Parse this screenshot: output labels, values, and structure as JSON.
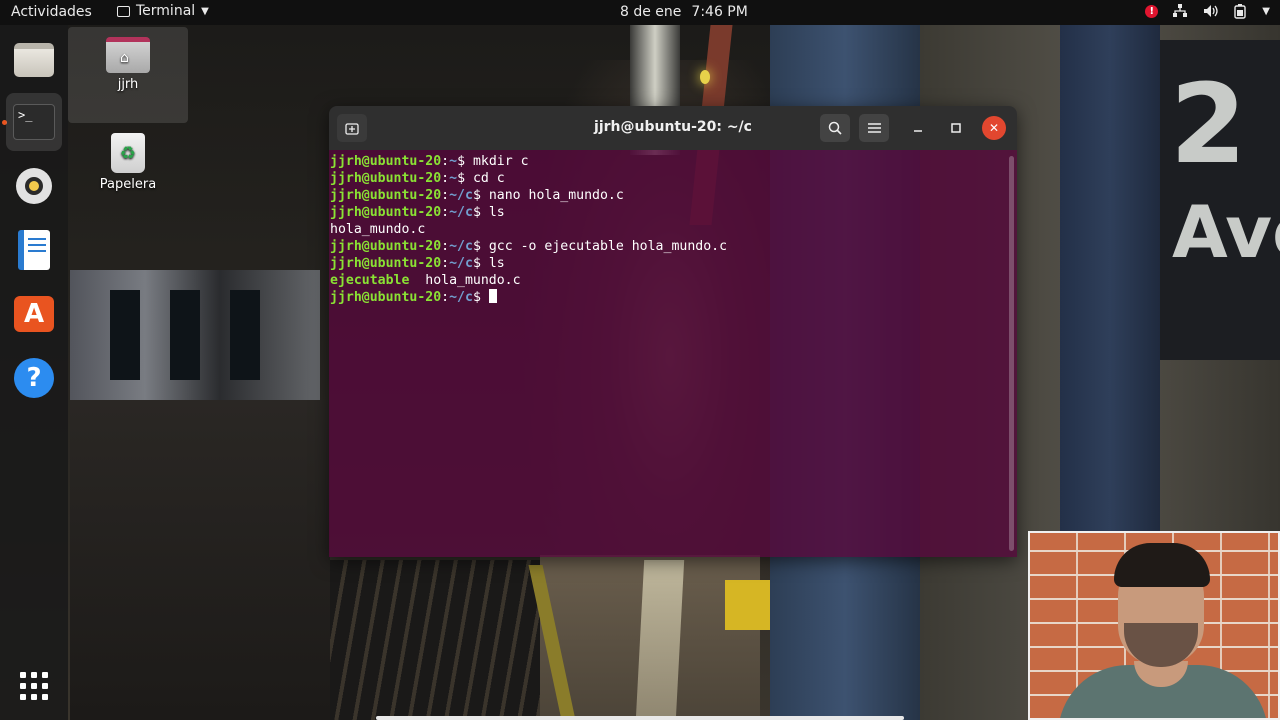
{
  "topbar": {
    "activities": "Actividades",
    "app_name": "Terminal",
    "date": "8 de ene",
    "time": "7:46 PM",
    "alert_mark": "!",
    "icons": [
      "network-icon",
      "volume-icon",
      "battery-icon",
      "power-menu-caret"
    ]
  },
  "dock": {
    "items": [
      "files",
      "terminal",
      "rhythmbox",
      "libreoffice-writer",
      "ubuntu-software",
      "help"
    ],
    "terminal_glyph": ">_",
    "software_glyph": "A",
    "help_glyph": "?"
  },
  "desktop": {
    "home_label": "jjrh",
    "trash_label": "Papelera"
  },
  "terminal": {
    "title": "jjrh@ubuntu-20: ~/c",
    "close_glyph": "✕",
    "lines": [
      {
        "user": "jjrh@ubuntu-20",
        "path": "~",
        "cmd": "mkdir c"
      },
      {
        "user": "jjrh@ubuntu-20",
        "path": "~",
        "cmd": "cd c"
      },
      {
        "user": "jjrh@ubuntu-20",
        "path": "~/c",
        "cmd": "nano hola_mundo.c"
      },
      {
        "user": "jjrh@ubuntu-20",
        "path": "~/c",
        "cmd": "ls"
      },
      {
        "output": "hola_mundo.c"
      },
      {
        "user": "jjrh@ubuntu-20",
        "path": "~/c",
        "cmd": "gcc -o ejecutable hola_mundo.c"
      },
      {
        "user": "jjrh@ubuntu-20",
        "path": "~/c",
        "cmd": "ls"
      },
      {
        "exec": "ejecutable",
        "output": "  hola_mundo.c"
      },
      {
        "user": "jjrh@ubuntu-20",
        "path": "~/c",
        "cmd": "",
        "cursor": true
      }
    ]
  },
  "wallpaper": {
    "sign_number": "2",
    "sign_text": "Ave"
  },
  "colors": {
    "terminal_bg": "#54083b",
    "prompt_user": "#8ae234",
    "prompt_path": "#729fcf",
    "close_button": "#e2472f",
    "accent": "#e95420"
  }
}
